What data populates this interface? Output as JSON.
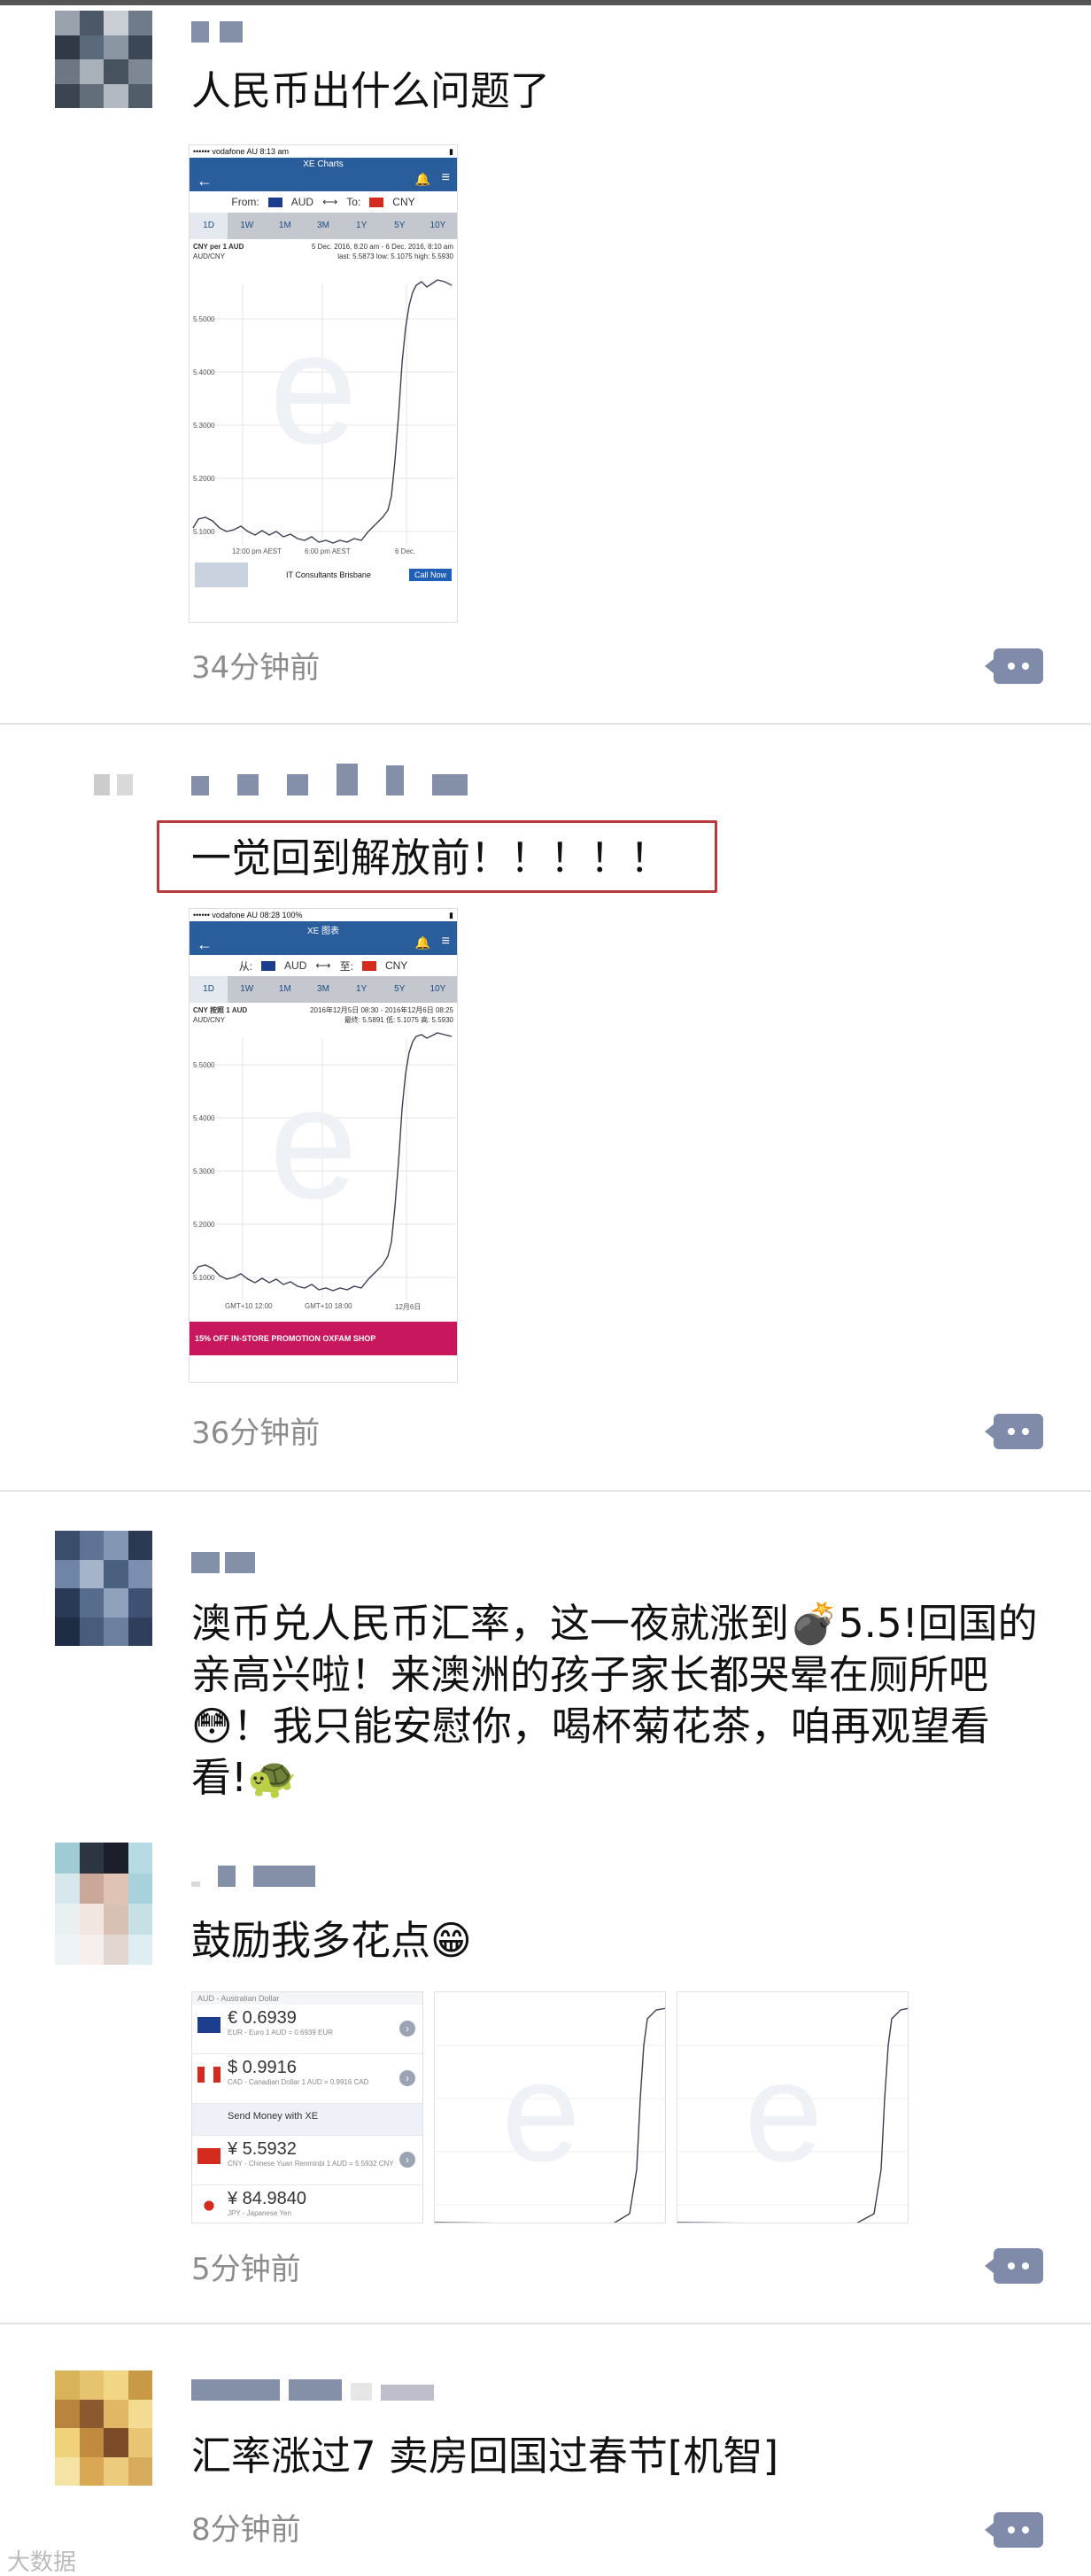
{
  "posts": [
    {
      "text": "人民币出什么问题了",
      "time": "34分钟前"
    },
    {
      "text": "一觉回到解放前！！！！！",
      "time": "36分钟前"
    },
    {
      "text": "澳币兑人民币汇率，这一夜就涨到💣5.5!回国的亲高兴啦！来澳洲的孩子家长都哭晕在厕所吧😳！我只能安慰你，喝杯菊花茶，咱再观望看看!🐢",
      "time": ""
    },
    {
      "text": "鼓励我多花点😁",
      "time": "5分钟前"
    },
    {
      "text": "汇率涨过7 卖房回国过春节[机智]",
      "time": "8分钟前"
    }
  ],
  "screens": [
    {
      "status": "•••••• vodafone AU 8:13 am",
      "title": "XE Charts",
      "from_label": "From:",
      "from": "AUD",
      "to_label": "To:",
      "to": "CNY",
      "tabs": [
        "1D",
        "1W",
        "1M",
        "3M",
        "1Y",
        "5Y",
        "10Y"
      ],
      "head1": "CNY per 1 AUD",
      "head2": "AUD/CNY",
      "range": "5 Dec. 2016, 8:20 am - 6 Dec. 2016, 8:10 am",
      "stats": "last: 5.5873   low: 5.1075   high: 5.5930",
      "yticks": [
        "5.5000",
        "5.4000",
        "5.3000",
        "5.2000",
        "5.1000"
      ],
      "xticks": [
        "12:00 pm AEST",
        "6:00 pm AEST",
        "6 Dec."
      ],
      "ad_text": "IT Consultants Brisbane",
      "ad_btn": "Call Now"
    },
    {
      "status": "•••••• vodafone AU 08:28 100%",
      "title": "XE 图表",
      "from_label": "从:",
      "from": "AUD",
      "to_label": "至:",
      "to": "CNY",
      "tabs": [
        "1D",
        "1W",
        "1M",
        "3M",
        "1Y",
        "5Y",
        "10Y"
      ],
      "head1": "CNY 按照 1 AUD",
      "head2": "AUD/CNY",
      "range": "2016年12月5日 08:30 - 2016年12月6日 08:25",
      "stats": "最终: 5.5891  低: 5.1075  高: 5.5930",
      "yticks": [
        "5.5000",
        "5.4000",
        "5.3000",
        "5.2000",
        "5.1000"
      ],
      "xticks": [
        "GMT+10 12:00",
        "GMT+10 18:00",
        "12月6日"
      ],
      "ad_text": "15% OFF IN-STORE PROMOTION   OXFAM SHOP",
      "ad_btn": ""
    }
  ],
  "xe_rows": [
    {
      "amt": "€ 0.6939",
      "sub": "EUR - Euro  1 AUD = 0.6939 EUR"
    },
    {
      "amt": "$ 0.9916",
      "sub": "CAD - Canadian Dollar  1 AUD = 0.9916 CAD"
    },
    {
      "amt": "Send Money with XE",
      "sub": ""
    },
    {
      "amt": "¥ 5.5932",
      "sub": "CNY - Chinese Yuan Renminbi  1 AUD = 5.5932 CNY"
    },
    {
      "amt": "¥ 84.9840",
      "sub": "JPY - Japanese Yen"
    }
  ],
  "xe_header": "AUD - Australian Dollar",
  "watermark": "大数据"
}
